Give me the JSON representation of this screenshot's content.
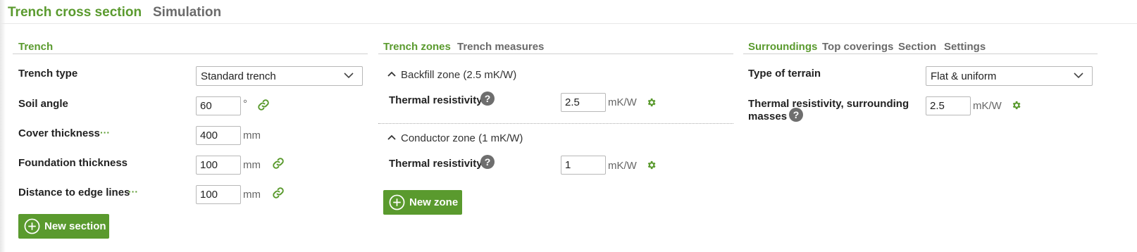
{
  "topnav": {
    "tab_trench_cross_section": "Trench cross section",
    "tab_simulation": "Simulation"
  },
  "trench_panel": {
    "tab_trench": "Trench",
    "trench_type_label": "Trench type",
    "trench_type_value": "Standard trench",
    "soil_angle_label": "Soil angle",
    "soil_angle_value": "60",
    "soil_angle_unit": "°",
    "cover_thickness_label": "Cover thickness",
    "cover_thickness_value": "400",
    "cover_thickness_unit": "mm",
    "foundation_thickness_label": "Foundation thickness",
    "foundation_thickness_value": "100",
    "foundation_thickness_unit": "mm",
    "distance_label": "Distance to edge lines",
    "distance_value": "100",
    "distance_unit": "mm",
    "more_icon": "···",
    "new_section_label": "New section"
  },
  "zones_panel": {
    "tab_trench_zones": "Trench zones",
    "tab_trench_measures": "Trench measures",
    "zones": [
      {
        "header": "Backfill zone (2.5 mK/W)",
        "label": "Thermal resistivity",
        "value": "2.5",
        "unit": "mK/W"
      },
      {
        "header": "Conductor zone (1 mK/W)",
        "label": "Thermal resistivity",
        "value": "1",
        "unit": "mK/W"
      }
    ],
    "help_icon": "?",
    "new_zone_label": "New zone"
  },
  "surroundings_panel": {
    "tab_surroundings": "Surroundings",
    "tab_top_coverings": "Top coverings",
    "tab_section": "Section",
    "tab_settings": "Settings",
    "terrain_label": "Type of terrain",
    "terrain_value": "Flat & uniform",
    "resistivity_label_line1": "Thermal resistivity, surrounding",
    "resistivity_label_line2": "masses",
    "resistivity_value": "2.5",
    "resistivity_unit": "mK/W"
  },
  "colors": {
    "accent": "#5a9a2e",
    "help_bg": "#6e6e6e"
  }
}
